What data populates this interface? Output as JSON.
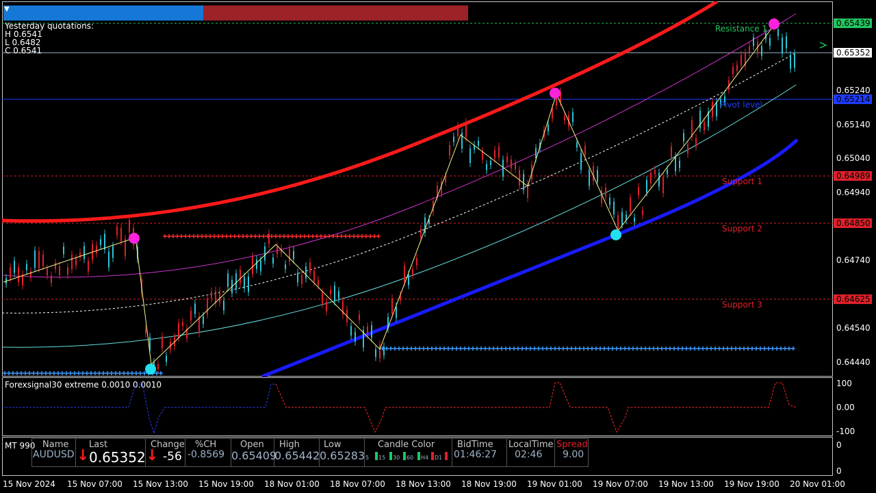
{
  "chart_data": {
    "type": "candlestick",
    "symbol": "AUDUSD",
    "x_ticks": [
      "15 Nov 2024",
      "15 Nov 07:00",
      "15 Nov 13:00",
      "15 Nov 19:00",
      "18 Nov 01:00",
      "18 Nov 07:00",
      "18 Nov 13:00",
      "18 Nov 19:00",
      "19 Nov 01:00",
      "19 Nov 07:00",
      "19 Nov 13:00",
      "19 Nov 19:00",
      "20 Nov 01:00"
    ],
    "y_ticks": [
      "0.65352",
      "0.65240",
      "0.65140",
      "0.65040",
      "0.64940",
      "0.64740",
      "0.64540",
      "0.64440"
    ],
    "ylim": [
      0.644,
      0.656
    ],
    "levels": [
      {
        "name": "Resistance 1",
        "price": "0.65439",
        "value": 0.65439,
        "color": "#22c55e"
      },
      {
        "name": "Pivot level",
        "price": "0.65214",
        "value": 0.65214,
        "color": "#1f3bff"
      },
      {
        "name": "Support 1",
        "price": "0.64989",
        "value": 0.64989,
        "color": "#e0202a"
      },
      {
        "name": "Support 2",
        "price": "0.64850",
        "value": 0.6485,
        "color": "#e0202a"
      },
      {
        "name": "Support 3",
        "price": "0.64625",
        "value": 0.64625,
        "color": "#e0202a"
      }
    ],
    "current_price": "0.65352",
    "zigzag": [
      0.6498,
      0.6482,
      0.6541,
      0.6475,
      0.6502,
      0.6442,
      0.6511,
      0.649,
      0.6525,
      0.6487,
      0.6545
    ]
  },
  "quotations": {
    "title": "Yesterday quotations:",
    "high": "H 0.6541",
    "low": "L 0.6482",
    "close": "C 0.6541"
  },
  "indicator": {
    "label": "Forexsignal30 extreme 0.0010 0.0010",
    "ticks": [
      "100",
      "0.00",
      "-100"
    ]
  },
  "panel": {
    "mt_label": "MT 990",
    "headers": [
      "Name",
      "Last",
      "Change",
      "%CH",
      "Open",
      "High",
      "Low",
      "Candle Color",
      "BidTime",
      "LocalTime",
      "Spread"
    ],
    "name": "AUDUSD",
    "last": "0.65352",
    "change": "-56",
    "pct_change": "-0.8569",
    "open": "0.65409",
    "high": "0.65442",
    "low": "0.65283",
    "candle_tf": [
      "5",
      "15",
      "30",
      "60",
      "H4",
      "D1"
    ],
    "bid_time": "01:46:27",
    "local_time": "02:46",
    "spread": "9.00"
  },
  "colors": {
    "bull_candle": "#2ec4d6",
    "bear_candle": "#e0202a",
    "upper_band": "#ff1a1a",
    "lower_band": "#1a1aff",
    "spread_header": "#e0202a"
  }
}
